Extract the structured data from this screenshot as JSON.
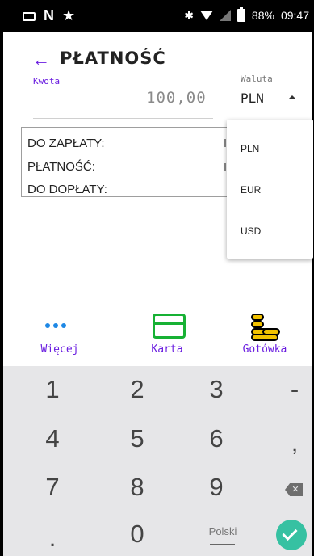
{
  "status_bar": {
    "battery": "88%",
    "time": "09:47",
    "icons": [
      "keyboard-icon",
      "n-icon",
      "star-icon",
      "bluetooth-icon",
      "wifi-icon",
      "signal-icon",
      "battery-icon"
    ]
  },
  "header": {
    "title": "PŁATNOŚĆ",
    "back_icon": "←"
  },
  "amount": {
    "label": "Kwota",
    "value": "100,00"
  },
  "currency": {
    "label": "Waluta",
    "selected": "PLN",
    "options": [
      "PLN",
      "EUR",
      "USD"
    ]
  },
  "summary": {
    "rows": [
      "DO ZAPŁATY:",
      "PŁATNOŚĆ:",
      "DO DOPŁATY:"
    ]
  },
  "methods": [
    {
      "label": "Więcej",
      "icon": "more-icon"
    },
    {
      "label": "Karta",
      "icon": "card-icon"
    },
    {
      "label": "Gotówka",
      "icon": "coins-icon"
    }
  ],
  "keypad": {
    "keys": [
      "1",
      "2",
      "3",
      "-",
      "4",
      "5",
      "6",
      ",",
      "7",
      "8",
      "9",
      ".",
      "0"
    ],
    "space_label": "Polski"
  },
  "colors": {
    "accent": "#6a1de0",
    "more": "#1e88e5",
    "card": "#17b134",
    "coins": "#f2c200",
    "confirm": "#36c1a2"
  }
}
